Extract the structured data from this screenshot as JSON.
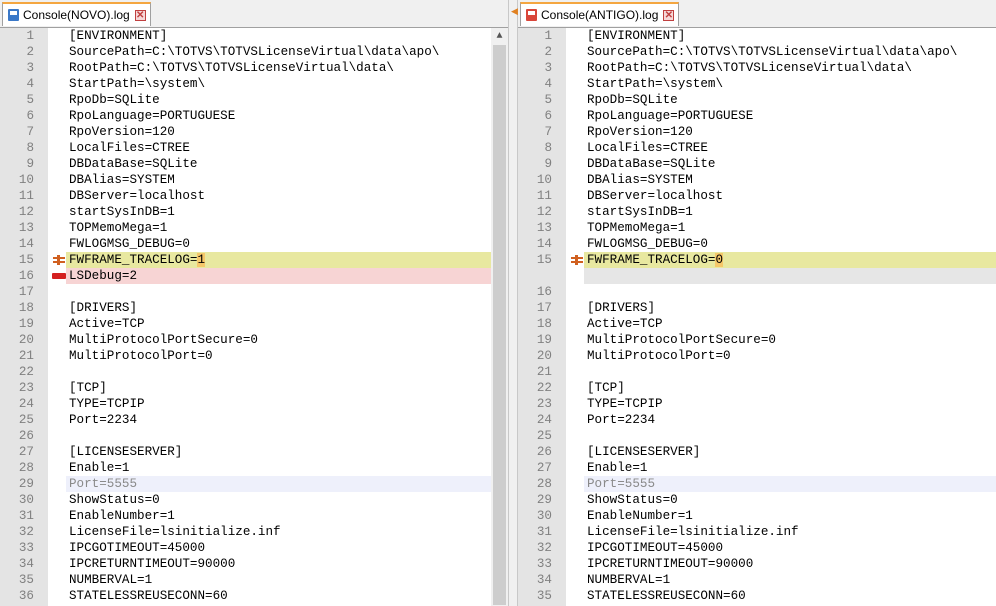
{
  "left": {
    "tab_label": "Console(NOVO).log",
    "close_glyph": "✕",
    "lines": [
      {
        "n": "1",
        "t": "[ENVIRONMENT]"
      },
      {
        "n": "2",
        "t": "SourcePath=C:\\TOTVS\\TOTVSLicenseVirtual\\data\\apo\\"
      },
      {
        "n": "3",
        "t": "RootPath=C:\\TOTVS\\TOTVSLicenseVirtual\\data\\"
      },
      {
        "n": "4",
        "t": "StartPath=\\system\\"
      },
      {
        "n": "5",
        "t": "RpoDb=SQLite"
      },
      {
        "n": "6",
        "t": "RpoLanguage=PORTUGUESE"
      },
      {
        "n": "7",
        "t": "RpoVersion=120"
      },
      {
        "n": "8",
        "t": "LocalFiles=CTREE"
      },
      {
        "n": "9",
        "t": "DBDataBase=SQLite"
      },
      {
        "n": "10",
        "t": "DBAlias=SYSTEM"
      },
      {
        "n": "11",
        "t": "DBServer=localhost"
      },
      {
        "n": "12",
        "t": "startSysInDB=1"
      },
      {
        "n": "13",
        "t": "TOPMemoMega=1"
      },
      {
        "n": "14",
        "t": "FWLOGMSG_DEBUG=0"
      },
      {
        "n": "15",
        "t": "FWFRAME_TRACELOG=",
        "h": "1",
        "s": "changed"
      },
      {
        "n": "16",
        "t": "LSDebug=2",
        "s": "removed"
      },
      {
        "n": "17",
        "t": ""
      },
      {
        "n": "18",
        "t": "[DRIVERS]"
      },
      {
        "n": "19",
        "t": "Active=TCP"
      },
      {
        "n": "20",
        "t": "MultiProtocolPortSecure=0"
      },
      {
        "n": "21",
        "t": "MultiProtocolPort=0"
      },
      {
        "n": "22",
        "t": ""
      },
      {
        "n": "23",
        "t": "[TCP]"
      },
      {
        "n": "24",
        "t": "TYPE=TCPIP"
      },
      {
        "n": "25",
        "t": "Port=2234"
      },
      {
        "n": "26",
        "t": ""
      },
      {
        "n": "27",
        "t": "[LICENSESERVER]"
      },
      {
        "n": "28",
        "t": "Enable=1"
      },
      {
        "n": "29",
        "t": "Port=5555",
        "s": "current"
      },
      {
        "n": "30",
        "t": "ShowStatus=0"
      },
      {
        "n": "31",
        "t": "EnableNumber=1"
      },
      {
        "n": "32",
        "t": "LicenseFile=lsinitialize.inf"
      },
      {
        "n": "33",
        "t": "IPCGOTIMEOUT=45000"
      },
      {
        "n": "34",
        "t": "IPCRETURNTIMEOUT=90000"
      },
      {
        "n": "35",
        "t": "NUMBERVAL=1"
      },
      {
        "n": "36",
        "t": "STATELESSREUSECONN=60"
      }
    ]
  },
  "right": {
    "tab_label": "Console(ANTIGO).log",
    "close_glyph": "✕",
    "lines": [
      {
        "n": "1",
        "t": "[ENVIRONMENT]"
      },
      {
        "n": "2",
        "t": "SourcePath=C:\\TOTVS\\TOTVSLicenseVirtual\\data\\apo\\"
      },
      {
        "n": "3",
        "t": "RootPath=C:\\TOTVS\\TOTVSLicenseVirtual\\data\\"
      },
      {
        "n": "4",
        "t": "StartPath=\\system\\"
      },
      {
        "n": "5",
        "t": "RpoDb=SQLite"
      },
      {
        "n": "6",
        "t": "RpoLanguage=PORTUGUESE"
      },
      {
        "n": "7",
        "t": "RpoVersion=120"
      },
      {
        "n": "8",
        "t": "LocalFiles=CTREE"
      },
      {
        "n": "9",
        "t": "DBDataBase=SQLite"
      },
      {
        "n": "10",
        "t": "DBAlias=SYSTEM"
      },
      {
        "n": "11",
        "t": "DBServer=localhost"
      },
      {
        "n": "12",
        "t": "startSysInDB=1"
      },
      {
        "n": "13",
        "t": "TOPMemoMega=1"
      },
      {
        "n": "14",
        "t": "FWLOGMSG_DEBUG=0"
      },
      {
        "n": "15",
        "t": "FWFRAME_TRACELOG=",
        "h": "0",
        "s": "changed"
      },
      {
        "n": "",
        "t": "",
        "s": "blank"
      },
      {
        "n": "16",
        "t": ""
      },
      {
        "n": "17",
        "t": "[DRIVERS]"
      },
      {
        "n": "18",
        "t": "Active=TCP"
      },
      {
        "n": "19",
        "t": "MultiProtocolPortSecure=0"
      },
      {
        "n": "20",
        "t": "MultiProtocolPort=0"
      },
      {
        "n": "21",
        "t": ""
      },
      {
        "n": "22",
        "t": "[TCP]"
      },
      {
        "n": "23",
        "t": "TYPE=TCPIP"
      },
      {
        "n": "24",
        "t": "Port=2234"
      },
      {
        "n": "25",
        "t": ""
      },
      {
        "n": "26",
        "t": "[LICENSESERVER]"
      },
      {
        "n": "27",
        "t": "Enable=1"
      },
      {
        "n": "28",
        "t": "Port=5555",
        "s": "current"
      },
      {
        "n": "29",
        "t": "ShowStatus=0"
      },
      {
        "n": "30",
        "t": "EnableNumber=1"
      },
      {
        "n": "31",
        "t": "LicenseFile=lsinitialize.inf"
      },
      {
        "n": "32",
        "t": "IPCGOTIMEOUT=45000"
      },
      {
        "n": "33",
        "t": "IPCRETURNTIMEOUT=90000"
      },
      {
        "n": "34",
        "t": "NUMBERVAL=1"
      },
      {
        "n": "35",
        "t": "STATELESSREUSECONN=60"
      }
    ]
  },
  "colors": {
    "changed_line": "#e8e8a0",
    "removed_line": "#f7d4d4",
    "changed_char": "#f5c76a",
    "tab_accent": "#f4a640"
  },
  "icons": {
    "changed_marker": "changed-line-marker-icon",
    "removed_marker": "removed-line-marker-icon",
    "file_icon_left": "floppy-file-icon",
    "file_icon_right": "red-file-icon"
  },
  "scrollbar": {
    "up_glyph": "▲"
  }
}
